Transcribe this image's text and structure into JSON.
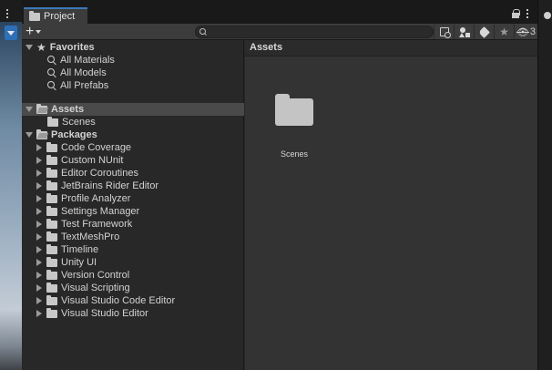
{
  "window": {
    "tab_title": "Project",
    "tab_icon": "folder-icon"
  },
  "toolbar": {
    "create_label": "+",
    "search_placeholder": "",
    "search_value": "",
    "hidden_count": "3"
  },
  "tree": {
    "favorites": {
      "label": "Favorites",
      "items": [
        {
          "label": "All Materials"
        },
        {
          "label": "All Models"
        },
        {
          "label": "All Prefabs"
        }
      ]
    },
    "assets": {
      "label": "Assets",
      "items": [
        {
          "label": "Scenes"
        }
      ]
    },
    "packages": {
      "label": "Packages",
      "items": [
        {
          "label": "Code Coverage"
        },
        {
          "label": "Custom NUnit"
        },
        {
          "label": "Editor Coroutines"
        },
        {
          "label": "JetBrains Rider Editor"
        },
        {
          "label": "Profile Analyzer"
        },
        {
          "label": "Settings Manager"
        },
        {
          "label": "Test Framework"
        },
        {
          "label": "TextMeshPro"
        },
        {
          "label": "Timeline"
        },
        {
          "label": "Unity UI"
        },
        {
          "label": "Version Control"
        },
        {
          "label": "Visual Scripting"
        },
        {
          "label": "Visual Studio Code Editor"
        },
        {
          "label": "Visual Studio Editor"
        }
      ]
    }
  },
  "content": {
    "header": "Assets",
    "items": [
      {
        "label": "Scenes",
        "icon": "folder-icon"
      }
    ]
  },
  "colors": {
    "accent": "#3a79bb",
    "panel": "#282828",
    "content_bg": "#333333",
    "selection": "#4a4a4a"
  }
}
